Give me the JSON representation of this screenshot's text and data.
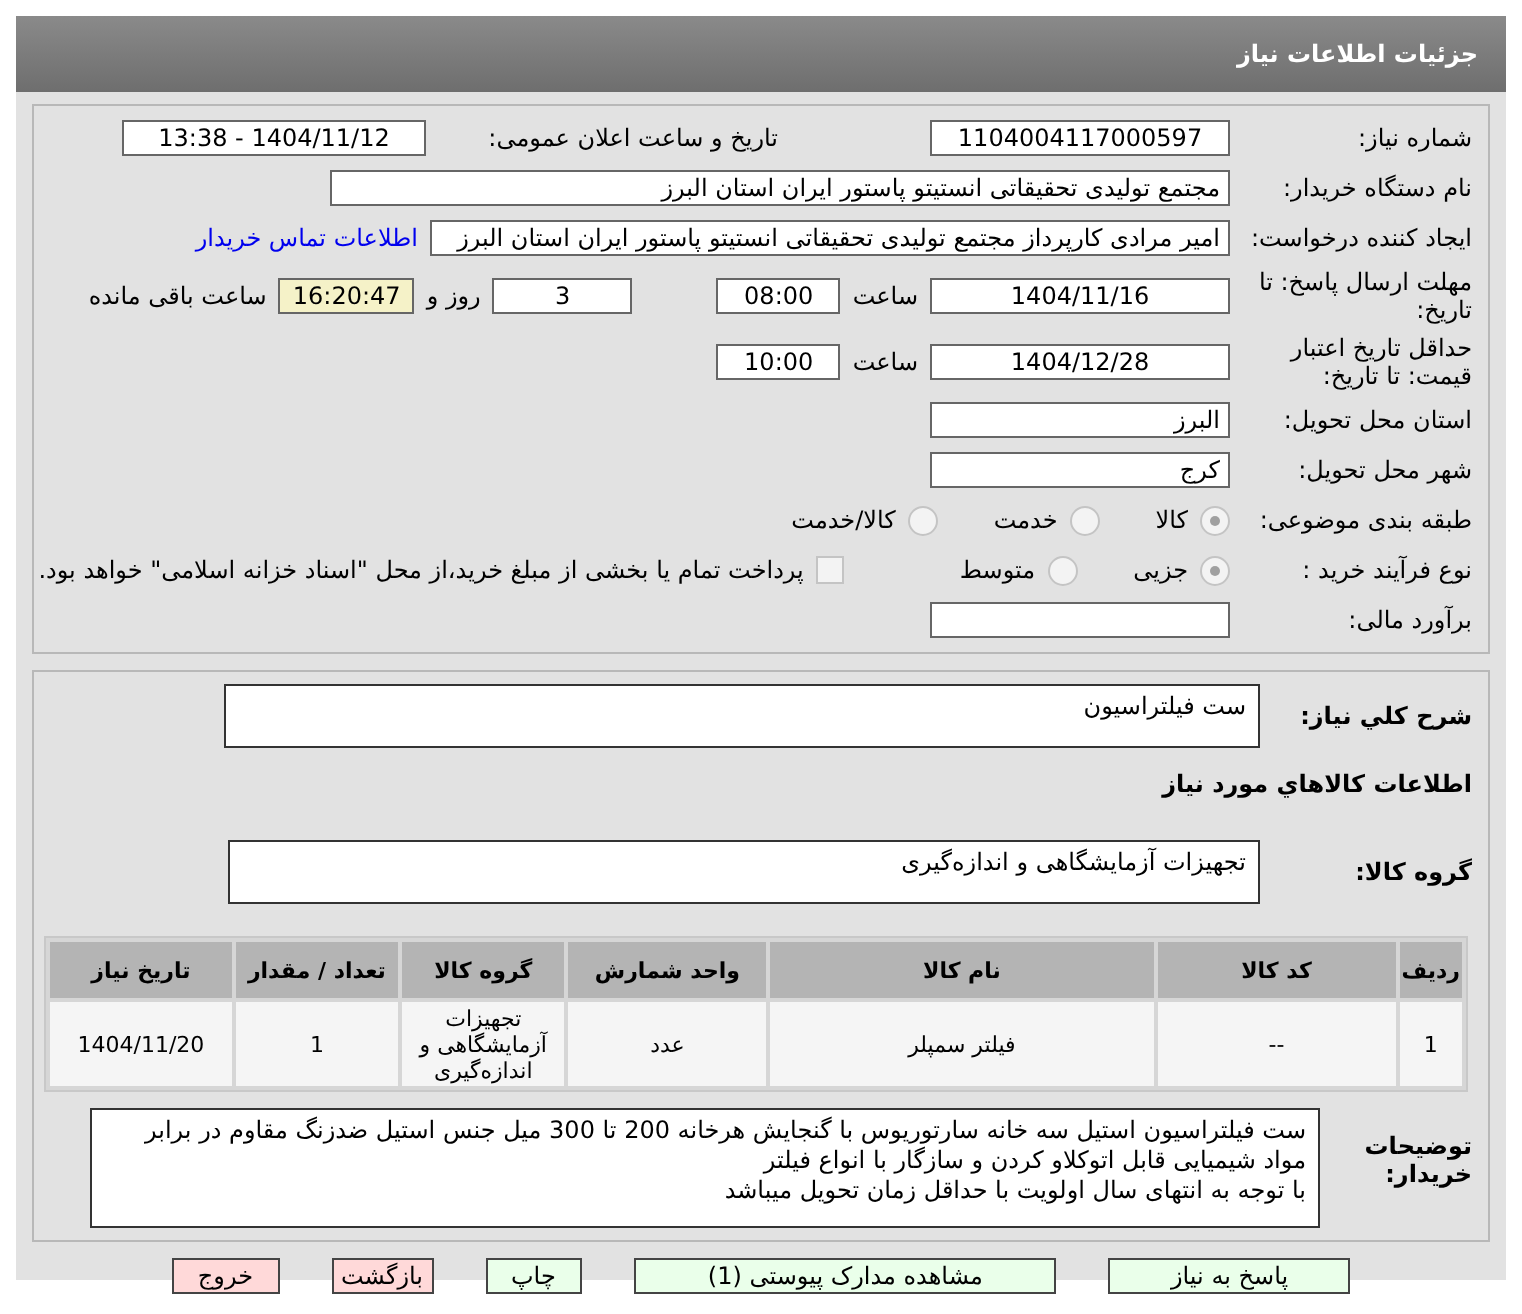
{
  "header": {
    "title": "جزئیات اطلاعات نیاز"
  },
  "need_number": {
    "label": "شماره نیاز:",
    "value": "1104004117000597"
  },
  "announce": {
    "label": "تاریخ و ساعت اعلان عمومی:",
    "value": "1404/11/12 - 13:38"
  },
  "buyer": {
    "label": "نام دستگاه خریدار:",
    "value": "مجتمع تولیدی تحقیقاتی انستیتو پاستور ایران استان البرز"
  },
  "requester": {
    "label": "ایجاد کننده درخواست:",
    "value": "امیر مرادی کارپرداز مجتمع تولیدی تحقیقاتی انستیتو پاستور ایران استان البرز",
    "link": "اطلاعات تماس خریدار"
  },
  "deadline": {
    "label": "مهلت ارسال پاسخ: تا تاریخ:",
    "date": "1404/11/16",
    "time_label": "ساعت",
    "time": "08:00",
    "days": "3",
    "days_label": "روز و",
    "remaining": "16:20:47",
    "remaining_label": "ساعت باقی مانده"
  },
  "validity": {
    "label": "حداقل تاریخ اعتبار قیمت: تا تاریخ:",
    "date": "1404/12/28",
    "time_label": "ساعت",
    "time": "10:00"
  },
  "province": {
    "label": "استان محل تحویل:",
    "value": "البرز"
  },
  "city": {
    "label": "شهر محل تحویل:",
    "value": "کرج"
  },
  "category": {
    "label": "طبقه بندی موضوعی:",
    "options": [
      {
        "label": "کالا",
        "selected": true
      },
      {
        "label": "خدمت",
        "selected": false
      },
      {
        "label": "کالا/خدمت",
        "selected": false
      }
    ]
  },
  "process": {
    "label": "نوع فرآیند خرید :",
    "options": [
      {
        "label": "جزیی",
        "selected": true
      },
      {
        "label": "متوسط",
        "selected": false
      }
    ],
    "payment": {
      "label": "پرداخت تمام یا بخشی از مبلغ خرید،از محل \"اسناد خزانه اسلامی\" خواهد بود.",
      "checked": false
    }
  },
  "estimate": {
    "label": "برآورد مالی:"
  },
  "summary": {
    "label": "شرح کلي نياز:",
    "value": "ست فیلتراسیون"
  },
  "goods_heading": "اطلاعات کالاهاي مورد نياز",
  "goods_group": {
    "label": "گروه کالا:",
    "value": "تجهیزات آزمایشگاهی و اندازه‌گیری"
  },
  "table": {
    "columns": [
      "ردیف",
      "کد کالا",
      "نام کالا",
      "واحد شمارش",
      "گروه کالا",
      "تعداد / مقدار",
      "تاریخ نیاز"
    ],
    "rows": [
      [
        "1",
        "--",
        "فیلتر سمپلر",
        "عدد",
        "تجهیزات آزمایشگاهی و اندازه‌گیری",
        "1",
        "1404/11/20"
      ]
    ]
  },
  "notes": {
    "label": "توضیحات خریدار:",
    "lines": [
      "ست فیلتراسیون استیل سه خانه سارتوریوس با گنجایش هرخانه 200 تا 300 میل جنس استیل ضدزنگ مقاوم در برابر مواد شیمیایی قابل اتوکلاو کردن و سازگار با انواع فیلتر",
      "با توجه به انتهای سال اولویت با حداقل زمان تحویل میباشد"
    ]
  },
  "buttons": [
    {
      "label": "پاسخ به نیاز",
      "color": "#eaffea"
    },
    {
      "label": "مشاهده مدارک پیوستی (1)",
      "color": "#eaffea"
    },
    {
      "label": "چاپ",
      "color": "#eaffea"
    },
    {
      "label": "بازگشت",
      "color": "#ffd9d9"
    },
    {
      "label": "خروج",
      "color": "#ffd9d9"
    }
  ]
}
